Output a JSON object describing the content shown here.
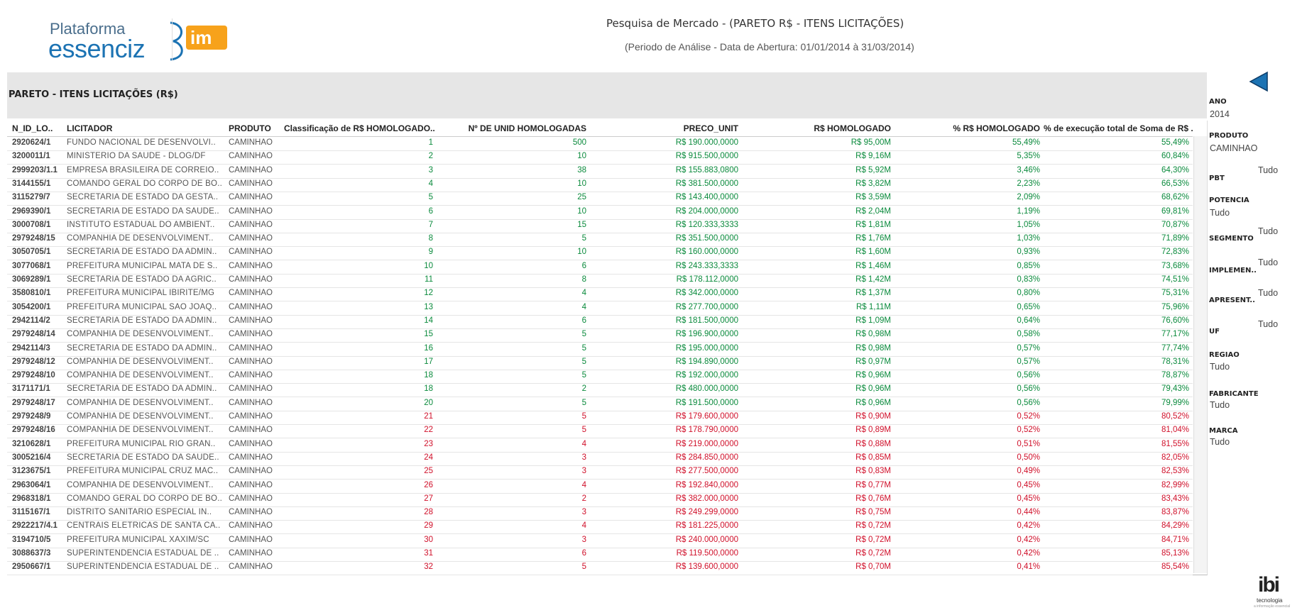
{
  "header": {
    "logo_platform": "Plataforma",
    "logo_essenciz": "essenciz",
    "logo_im": "im",
    "title": "Pesquisa de Mercado  - (PARETO R$ - ITENS LICITAÇÕES)",
    "subtitle": "(Periodo de Análise - Data de Abertura: 01/01/2014 à 31/03/2014)"
  },
  "section_title": "PARETO  - ITENS LICITAÇÕES (R$)",
  "columns": {
    "id": "N_ID_LO..",
    "licitador": "LICITADOR",
    "produto": "PRODUTO",
    "classificacao": "Classificação de R$ HOMOLOGADO..",
    "unid": "Nº DE UNID HOMOLOGADAS",
    "preco": "PRECO_UNIT",
    "rs": "R$ HOMOLOGADO",
    "pct": "% R$ HOMOLOGADO",
    "exec": "% de execução total de Soma de R$ .."
  },
  "rows": [
    {
      "id": "2920624/1",
      "lic": "FUNDO NACIONAL DE DESENVOLVI..",
      "prod": "CAMINHAO",
      "cls": "1",
      "uni": "500",
      "pre": "R$ 190.000,0000",
      "rs": "R$ 95,00M",
      "pct": "55,49%",
      "exe": "55,49%",
      "c": "g"
    },
    {
      "id": "3200011/1",
      "lic": "MINISTERIO DA SAUDE - DLOG/DF",
      "prod": "CAMINHAO",
      "cls": "2",
      "uni": "10",
      "pre": "R$ 915.500,0000",
      "rs": "R$ 9,16M",
      "pct": "5,35%",
      "exe": "60,84%",
      "c": "g"
    },
    {
      "id": "2999203/1.1",
      "lic": "EMPRESA BRASILEIRA DE CORREIO..",
      "prod": "CAMINHAO",
      "cls": "3",
      "uni": "38",
      "pre": "R$ 155.883,0800",
      "rs": "R$ 5,92M",
      "pct": "3,46%",
      "exe": "64,30%",
      "c": "g"
    },
    {
      "id": "3144155/1",
      "lic": "COMANDO GERAL DO CORPO DE BO..",
      "prod": "CAMINHAO",
      "cls": "4",
      "uni": "10",
      "pre": "R$ 381.500,0000",
      "rs": "R$ 3,82M",
      "pct": "2,23%",
      "exe": "66,53%",
      "c": "g"
    },
    {
      "id": "3115279/7",
      "lic": "SECRETARIA DE ESTADO DA GESTA..",
      "prod": "CAMINHAO",
      "cls": "5",
      "uni": "25",
      "pre": "R$ 143.400,0000",
      "rs": "R$ 3,59M",
      "pct": "2,09%",
      "exe": "68,62%",
      "c": "g"
    },
    {
      "id": "2969390/1",
      "lic": "SECRETARIA DE ESTADO DA SAUDE..",
      "prod": "CAMINHAO",
      "cls": "6",
      "uni": "10",
      "pre": "R$ 204.000,0000",
      "rs": "R$ 2,04M",
      "pct": "1,19%",
      "exe": "69,81%",
      "c": "g"
    },
    {
      "id": "3000708/1",
      "lic": "INSTITUTO ESTADUAL DO AMBIENT..",
      "prod": "CAMINHAO",
      "cls": "7",
      "uni": "15",
      "pre": "R$ 120.333,3333",
      "rs": "R$ 1,81M",
      "pct": "1,05%",
      "exe": "70,87%",
      "c": "g"
    },
    {
      "id": "2979248/15",
      "lic": "COMPANHIA DE DESENVOLVIMENT..",
      "prod": "CAMINHAO",
      "cls": "8",
      "uni": "5",
      "pre": "R$ 351.500,0000",
      "rs": "R$ 1,76M",
      "pct": "1,03%",
      "exe": "71,89%",
      "c": "g"
    },
    {
      "id": "3050705/1",
      "lic": "SECRETARIA DE ESTADO DA ADMIN..",
      "prod": "CAMINHAO",
      "cls": "9",
      "uni": "10",
      "pre": "R$ 160.000,0000",
      "rs": "R$ 1,60M",
      "pct": "0,93%",
      "exe": "72,83%",
      "c": "g"
    },
    {
      "id": "3077068/1",
      "lic": "PREFEITURA MUNICIPAL MATA DE S..",
      "prod": "CAMINHAO",
      "cls": "10",
      "uni": "6",
      "pre": "R$ 243.333,3333",
      "rs": "R$ 1,46M",
      "pct": "0,85%",
      "exe": "73,68%",
      "c": "g"
    },
    {
      "id": "3069289/1",
      "lic": "SECRETARIA DE ESTADO DA AGRIC..",
      "prod": "CAMINHAO",
      "cls": "11",
      "uni": "8",
      "pre": "R$ 178.112,0000",
      "rs": "R$ 1,42M",
      "pct": "0,83%",
      "exe": "74,51%",
      "c": "g"
    },
    {
      "id": "3580810/1",
      "lic": "PREFEITURA MUNICIPAL IBIRITE/MG",
      "prod": "CAMINHAO",
      "cls": "12",
      "uni": "4",
      "pre": "R$ 342.000,0000",
      "rs": "R$ 1,37M",
      "pct": "0,80%",
      "exe": "75,31%",
      "c": "g"
    },
    {
      "id": "3054200/1",
      "lic": "PREFEITURA MUNICIPAL SAO JOAQ..",
      "prod": "CAMINHAO",
      "cls": "13",
      "uni": "4",
      "pre": "R$ 277.700,0000",
      "rs": "R$ 1,11M",
      "pct": "0,65%",
      "exe": "75,96%",
      "c": "g"
    },
    {
      "id": "2942114/2",
      "lic": "SECRETARIA DE ESTADO DA ADMIN..",
      "prod": "CAMINHAO",
      "cls": "14",
      "uni": "6",
      "pre": "R$ 181.500,0000",
      "rs": "R$ 1,09M",
      "pct": "0,64%",
      "exe": "76,60%",
      "c": "g"
    },
    {
      "id": "2979248/14",
      "lic": "COMPANHIA DE DESENVOLVIMENT..",
      "prod": "CAMINHAO",
      "cls": "15",
      "uni": "5",
      "pre": "R$ 196.900,0000",
      "rs": "R$ 0,98M",
      "pct": "0,58%",
      "exe": "77,17%",
      "c": "g"
    },
    {
      "id": "2942114/3",
      "lic": "SECRETARIA DE ESTADO DA ADMIN..",
      "prod": "CAMINHAO",
      "cls": "16",
      "uni": "5",
      "pre": "R$ 195.000,0000",
      "rs": "R$ 0,98M",
      "pct": "0,57%",
      "exe": "77,74%",
      "c": "g"
    },
    {
      "id": "2979248/12",
      "lic": "COMPANHIA DE DESENVOLVIMENT..",
      "prod": "CAMINHAO",
      "cls": "17",
      "uni": "5",
      "pre": "R$ 194.890,0000",
      "rs": "R$ 0,97M",
      "pct": "0,57%",
      "exe": "78,31%",
      "c": "g"
    },
    {
      "id": "2979248/10",
      "lic": "COMPANHIA DE DESENVOLVIMENT..",
      "prod": "CAMINHAO",
      "cls": "18",
      "uni": "5",
      "pre": "R$ 192.000,0000",
      "rs": "R$ 0,96M",
      "pct": "0,56%",
      "exe": "78,87%",
      "c": "g"
    },
    {
      "id": "3171171/1",
      "lic": "SECRETARIA DE ESTADO DA ADMIN..",
      "prod": "CAMINHAO",
      "cls": "18",
      "uni": "2",
      "pre": "R$ 480.000,0000",
      "rs": "R$ 0,96M",
      "pct": "0,56%",
      "exe": "79,43%",
      "c": "g"
    },
    {
      "id": "2979248/17",
      "lic": "COMPANHIA DE DESENVOLVIMENT..",
      "prod": "CAMINHAO",
      "cls": "20",
      "uni": "5",
      "pre": "R$ 191.500,0000",
      "rs": "R$ 0,96M",
      "pct": "0,56%",
      "exe": "79,99%",
      "c": "g"
    },
    {
      "id": "2979248/9",
      "lic": "COMPANHIA DE DESENVOLVIMENT..",
      "prod": "CAMINHAO",
      "cls": "21",
      "uni": "5",
      "pre": "R$ 179.600,0000",
      "rs": "R$ 0,90M",
      "pct": "0,52%",
      "exe": "80,52%",
      "c": "r"
    },
    {
      "id": "2979248/16",
      "lic": "COMPANHIA DE DESENVOLVIMENT..",
      "prod": "CAMINHAO",
      "cls": "22",
      "uni": "5",
      "pre": "R$ 178.790,0000",
      "rs": "R$ 0,89M",
      "pct": "0,52%",
      "exe": "81,04%",
      "c": "r"
    },
    {
      "id": "3210628/1",
      "lic": "PREFEITURA MUNICIPAL RIO GRAN..",
      "prod": "CAMINHAO",
      "cls": "23",
      "uni": "4",
      "pre": "R$ 219.000,0000",
      "rs": "R$ 0,88M",
      "pct": "0,51%",
      "exe": "81,55%",
      "c": "r"
    },
    {
      "id": "3005216/4",
      "lic": "SECRETARIA DE ESTADO DA SAUDE..",
      "prod": "CAMINHAO",
      "cls": "24",
      "uni": "3",
      "pre": "R$ 284.850,0000",
      "rs": "R$ 0,85M",
      "pct": "0,50%",
      "exe": "82,05%",
      "c": "r"
    },
    {
      "id": "3123675/1",
      "lic": "PREFEITURA MUNICIPAL CRUZ MAC..",
      "prod": "CAMINHAO",
      "cls": "25",
      "uni": "3",
      "pre": "R$ 277.500,0000",
      "rs": "R$ 0,83M",
      "pct": "0,49%",
      "exe": "82,53%",
      "c": "r"
    },
    {
      "id": "2963064/1",
      "lic": "COMPANHIA DE DESENVOLVIMENT..",
      "prod": "CAMINHAO",
      "cls": "26",
      "uni": "4",
      "pre": "R$ 192.840,0000",
      "rs": "R$ 0,77M",
      "pct": "0,45%",
      "exe": "82,99%",
      "c": "r"
    },
    {
      "id": "2968318/1",
      "lic": "COMANDO GERAL DO CORPO DE BO..",
      "prod": "CAMINHAO",
      "cls": "27",
      "uni": "2",
      "pre": "R$ 382.000,0000",
      "rs": "R$ 0,76M",
      "pct": "0,45%",
      "exe": "83,43%",
      "c": "r"
    },
    {
      "id": "3115167/1",
      "lic": "DISTRITO SANITARIO ESPECIAL IN..",
      "prod": "CAMINHAO",
      "cls": "28",
      "uni": "3",
      "pre": "R$ 249.299,0000",
      "rs": "R$ 0,75M",
      "pct": "0,44%",
      "exe": "83,87%",
      "c": "r"
    },
    {
      "id": "2922217/4.1",
      "lic": "CENTRAIS ELETRICAS DE SANTA CA..",
      "prod": "CAMINHAO",
      "cls": "29",
      "uni": "4",
      "pre": "R$ 181.225,0000",
      "rs": "R$ 0,72M",
      "pct": "0,42%",
      "exe": "84,29%",
      "c": "r"
    },
    {
      "id": "3194710/5",
      "lic": "PREFEITURA MUNICIPAL XAXIM/SC",
      "prod": "CAMINHAO",
      "cls": "30",
      "uni": "3",
      "pre": "R$ 240.000,0000",
      "rs": "R$ 0,72M",
      "pct": "0,42%",
      "exe": "84,71%",
      "c": "r"
    },
    {
      "id": "3088637/3",
      "lic": "SUPERINTENDENCIA ESTADUAL DE ..",
      "prod": "CAMINHAO",
      "cls": "31",
      "uni": "6",
      "pre": "R$ 119.500,0000",
      "rs": "R$ 0,72M",
      "pct": "0,42%",
      "exe": "85,13%",
      "c": "r"
    },
    {
      "id": "2950667/1",
      "lic": "SUPERINTENDENCIA ESTADUAL DE ..",
      "prod": "CAMINHAO",
      "cls": "32",
      "uni": "5",
      "pre": "R$ 139.600,0000",
      "rs": "R$ 0,70M",
      "pct": "0,41%",
      "exe": "85,54%",
      "c": "r"
    }
  ],
  "colors": {
    "green": "#0a8a3c",
    "red": "#d0102a",
    "accent": "#1c73b3"
  },
  "filters": {
    "ano_label": "ANO",
    "ano_value": "2014",
    "produto_label": "PRODUTO",
    "produto_value": "CAMINHAO",
    "pbt_label": "PBT",
    "pbt_value": "Tudo",
    "potencia_label": "POTENCIA",
    "potencia_value": "Tudo",
    "segmento_label": "SEGMENTO",
    "segmento_value": "Tudo",
    "implem_label": "IMPLEMEN..",
    "implem_value": "Tudo",
    "apresent_label": "APRESENT..",
    "apresent_value": "Tudo",
    "uf_label": "UF",
    "uf_value": "Tudo",
    "regiao_label": "REGIAO",
    "regiao_value": "Tudo",
    "fabricante_label": "FABRICANTE",
    "fabricante_value": "Tudo",
    "marca_label": "MARCA",
    "marca_value": "Tudo"
  },
  "footer_logo": {
    "main": "ibi",
    "sub": "tecnologia",
    "sub2": "a informação essencial"
  }
}
